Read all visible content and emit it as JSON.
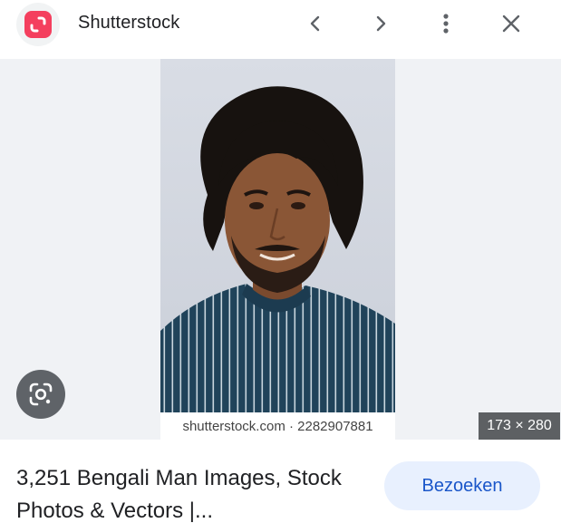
{
  "header": {
    "site_name": "Shutterstock",
    "favicon_icon": "shutterstock-logo-icon",
    "brand_color": "#f43f5e",
    "prev_icon": "chevron-left-icon",
    "next_icon": "chevron-right-icon",
    "more_icon": "more-vertical-icon",
    "close_icon": "close-icon"
  },
  "viewer": {
    "watermark": "shutterstock.com · 2282907881",
    "dimensions": "173 × 280",
    "lens_icon": "google-lens-icon"
  },
  "result": {
    "title": "3,251 Bengali Man Images, Stock Photos & Vectors |...",
    "visit_label": "Bezoeken"
  }
}
